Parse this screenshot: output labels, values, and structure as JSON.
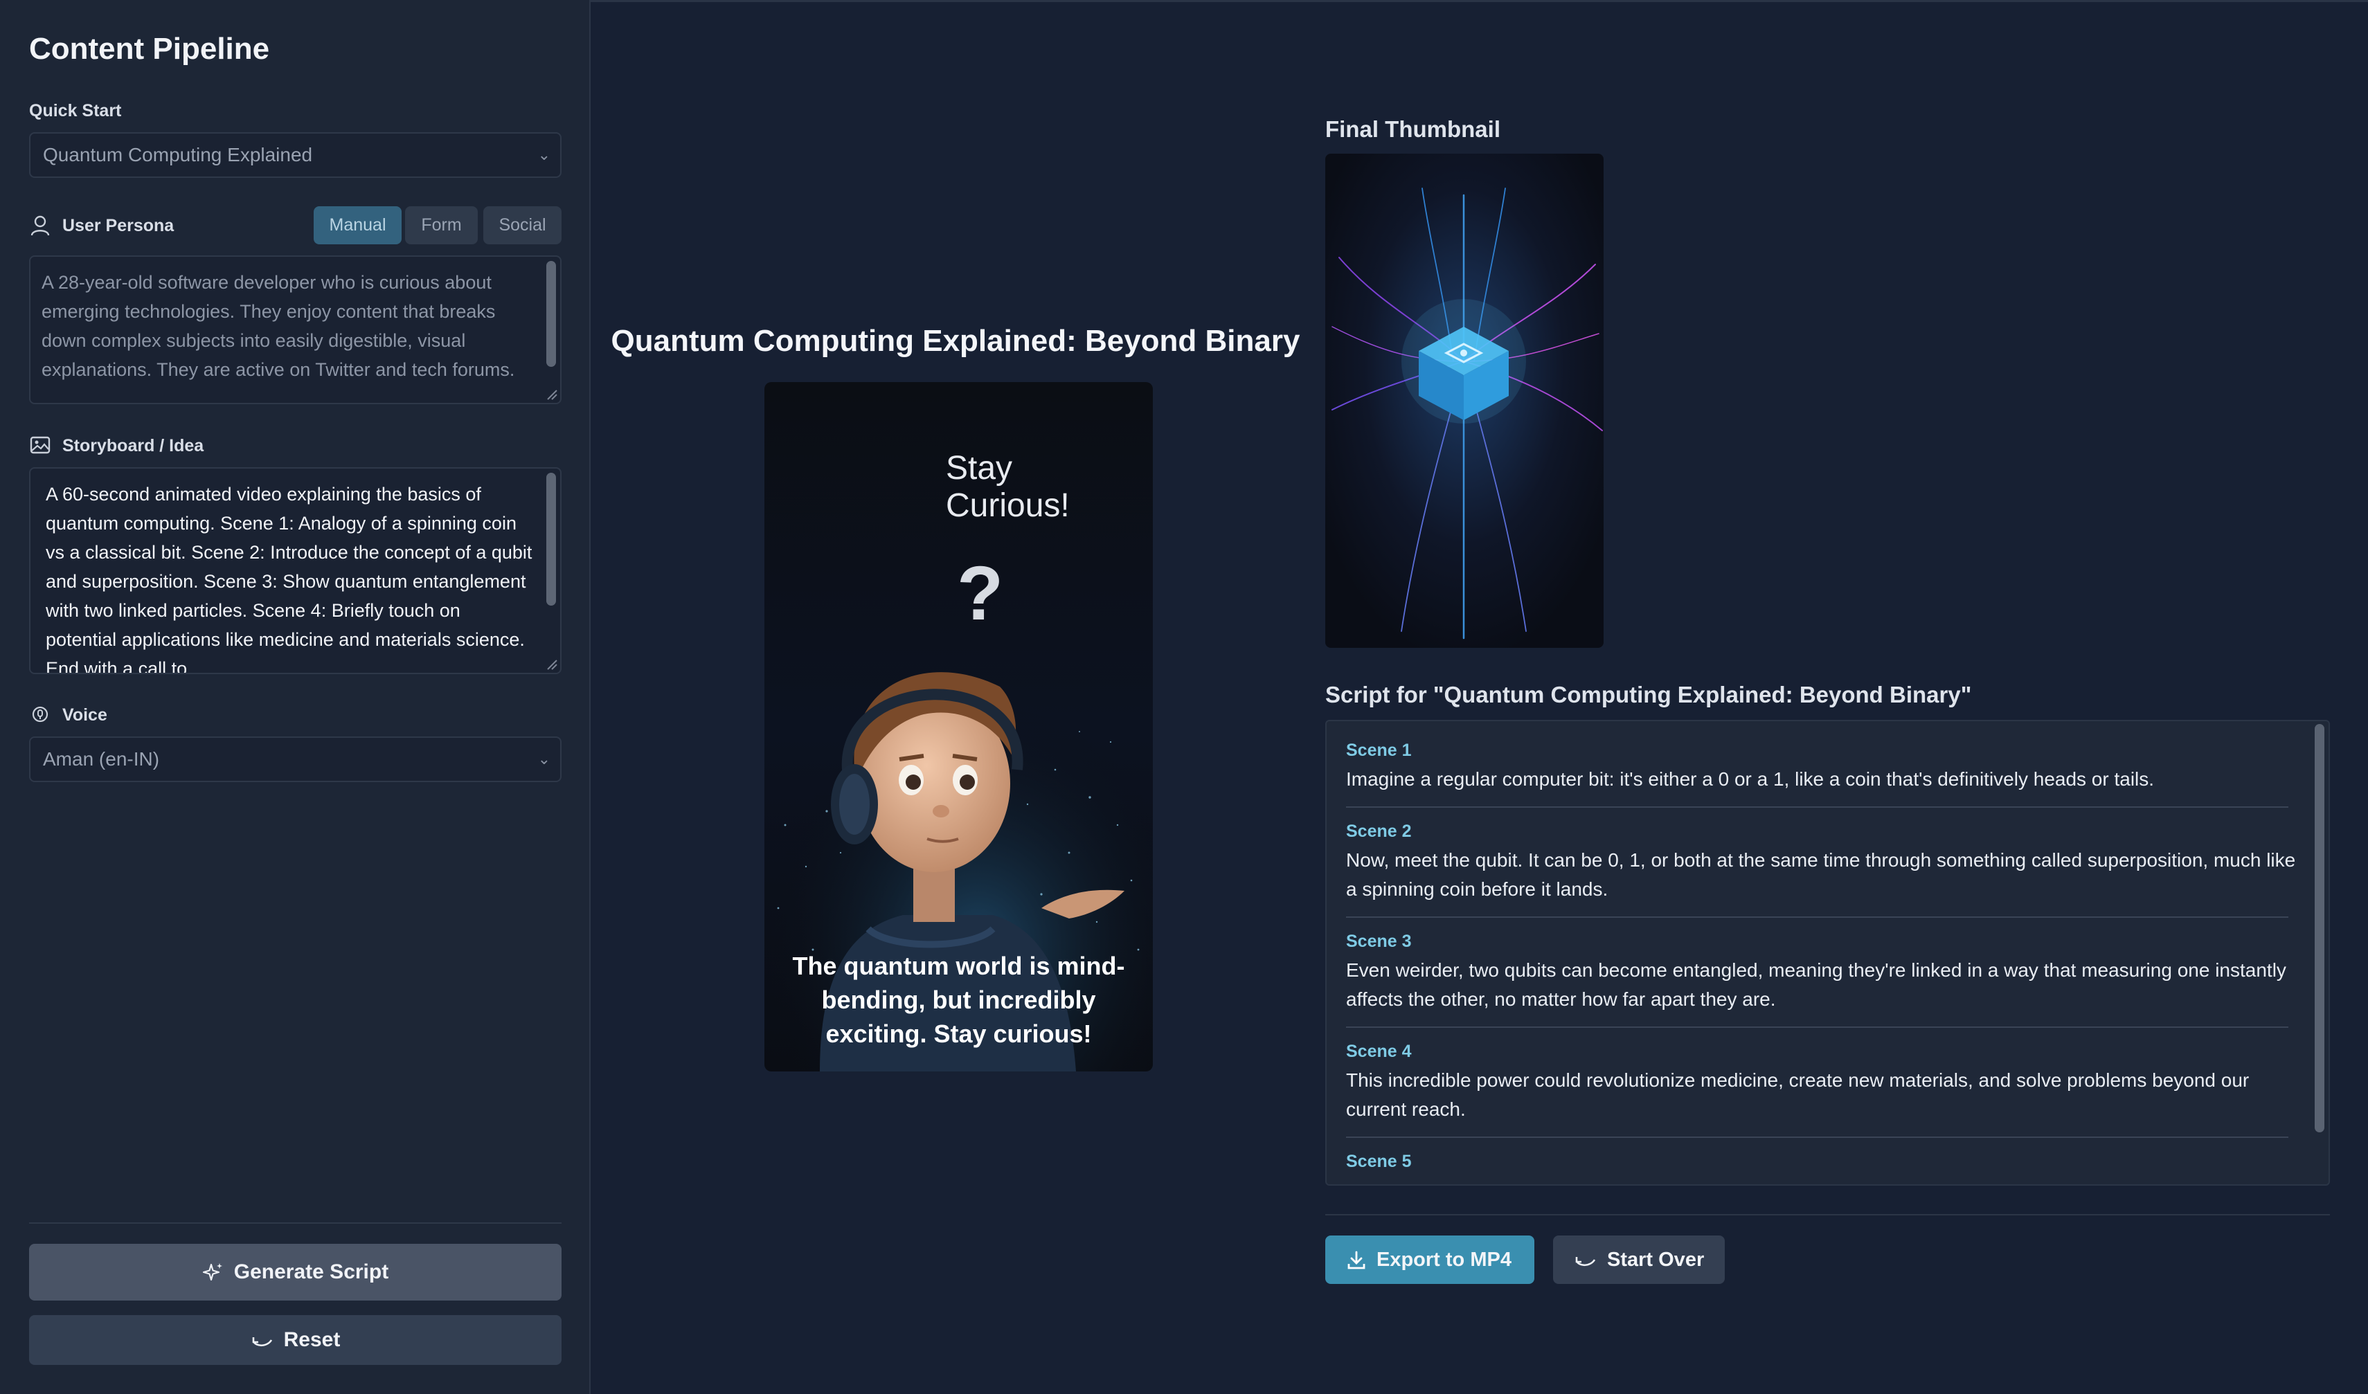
{
  "sidebar": {
    "title": "Content Pipeline",
    "quick_start": {
      "label": "Quick Start",
      "value": "Quantum Computing Explained"
    },
    "persona": {
      "label": "User Persona",
      "modes": [
        "Manual",
        "Form",
        "Social"
      ],
      "active_mode": "Manual",
      "text": "A 28-year-old software developer who is curious about emerging technologies. They enjoy content that breaks down complex subjects into easily digestible, visual explanations. They are active on Twitter and tech forums."
    },
    "storyboard": {
      "label": "Storyboard / Idea",
      "text": "A 60-second animated video explaining the basics of quantum computing. Scene 1: Analogy of a spinning coin vs a classical bit. Scene 2: Introduce the concept of a qubit and superposition. Scene 3: Show quantum entanglement with two linked particles. Scene 4: Briefly touch on potential applications like medicine and materials science. End with a call to"
    },
    "voice": {
      "label": "Voice",
      "value": "Aman (en-IN)"
    },
    "generate_label": "Generate Script",
    "reset_label": "Reset"
  },
  "preview": {
    "title": "Quantum Computing Explained: Beyond Binary",
    "overlay_text": "Stay\nCurious!",
    "overlay_mark": "?",
    "caption": "The quantum world is mind-bending, but incredibly exciting. Stay curious!"
  },
  "thumbnail": {
    "label": "Final Thumbnail"
  },
  "script": {
    "title": "Script for \"Quantum Computing Explained: Beyond Binary\"",
    "scenes": [
      {
        "name": "Scene 1",
        "text": "Imagine a regular computer bit: it's either a 0 or a 1, like a coin that's definitively heads or tails."
      },
      {
        "name": "Scene 2",
        "text": "Now, meet the qubit. It can be 0, 1, or both at the same time through something called superposition, much like a spinning coin before it lands."
      },
      {
        "name": "Scene 3",
        "text": "Even weirder, two qubits can become entangled, meaning they're linked in a way that measuring one instantly affects the other, no matter how far apart they are."
      },
      {
        "name": "Scene 4",
        "text": "This incredible power could revolutionize medicine, create new materials, and solve problems beyond our current reach."
      },
      {
        "name": "Scene 5",
        "text": ""
      }
    ]
  },
  "actions": {
    "export_label": "Export to MP4",
    "start_over_label": "Start Over"
  },
  "colors": {
    "background": "#172033",
    "sidebar": "#1d2636",
    "accent": "#3a8fb0",
    "scene_label": "#7fcbe5"
  }
}
